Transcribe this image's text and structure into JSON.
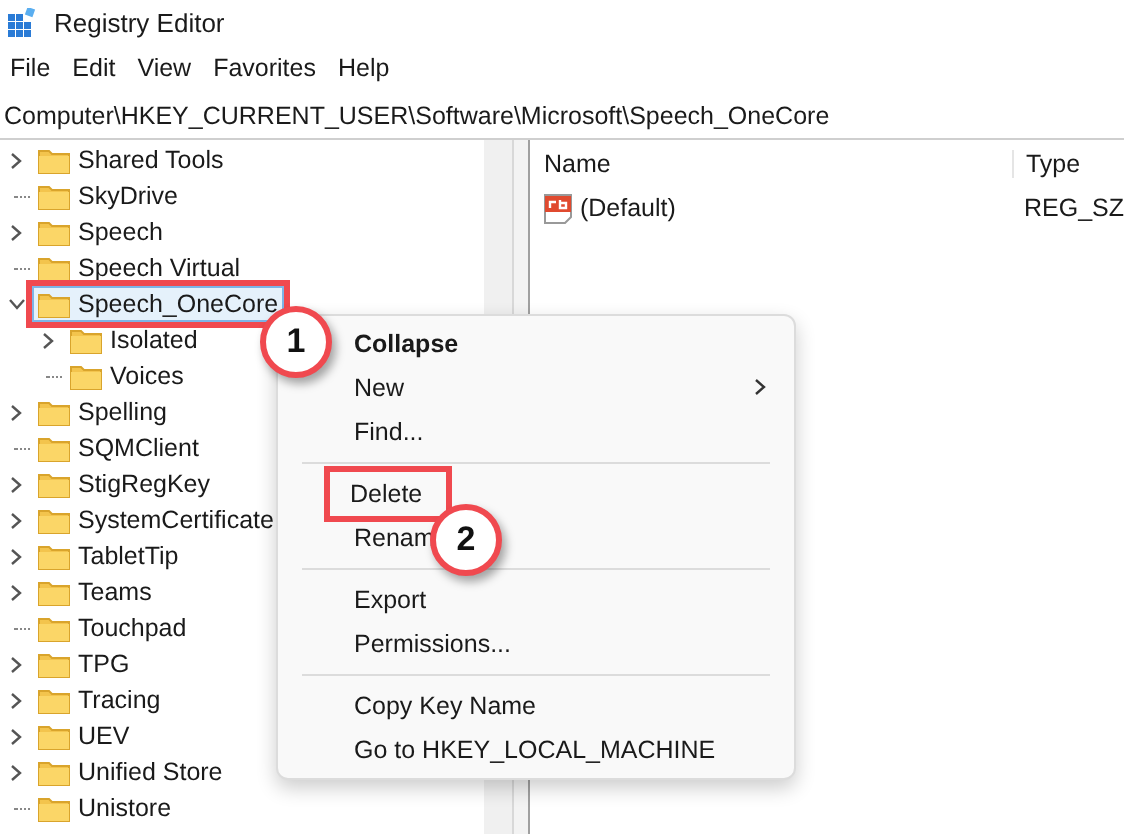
{
  "window": {
    "title": "Registry Editor"
  },
  "menu_bar": [
    "File",
    "Edit",
    "View",
    "Favorites",
    "Help"
  ],
  "address": "Computer\\HKEY_CURRENT_USER\\Software\\Microsoft\\Speech_OneCore",
  "tree": [
    {
      "label": "Shared Tools",
      "expandable": true,
      "expanded": false,
      "selected": false
    },
    {
      "label": "SkyDrive",
      "expandable": false,
      "selected": false
    },
    {
      "label": "Speech",
      "expandable": true,
      "expanded": false,
      "selected": false
    },
    {
      "label": "Speech Virtual",
      "expandable": false,
      "selected": false
    },
    {
      "label": "Speech_OneCore",
      "expandable": true,
      "expanded": true,
      "selected": true,
      "highlighted": true,
      "callout": "1",
      "children": [
        {
          "label": "Isolated",
          "expandable": true,
          "expanded": false,
          "selected": false
        },
        {
          "label": "Voices",
          "expandable": false,
          "selected": false
        }
      ]
    },
    {
      "label": "Spelling",
      "expandable": true,
      "expanded": false,
      "selected": false
    },
    {
      "label": "SQMClient",
      "expandable": false,
      "selected": false
    },
    {
      "label": "StigRegKey",
      "expandable": true,
      "expanded": false,
      "selected": false
    },
    {
      "label": "SystemCertificate",
      "expandable": true,
      "expanded": false,
      "selected": false
    },
    {
      "label": "TabletTip",
      "expandable": true,
      "expanded": false,
      "selected": false
    },
    {
      "label": "Teams",
      "expandable": true,
      "expanded": false,
      "selected": false
    },
    {
      "label": "Touchpad",
      "expandable": false,
      "selected": false
    },
    {
      "label": "TPG",
      "expandable": true,
      "expanded": false,
      "selected": false
    },
    {
      "label": "Tracing",
      "expandable": true,
      "expanded": false,
      "selected": false
    },
    {
      "label": "UEV",
      "expandable": true,
      "expanded": false,
      "selected": false
    },
    {
      "label": "Unified Store",
      "expandable": true,
      "expanded": false,
      "selected": false
    },
    {
      "label": "Unistore",
      "expandable": false,
      "selected": false
    }
  ],
  "values": {
    "columns": [
      "Name",
      "Type"
    ],
    "rows": [
      {
        "name": "(Default)",
        "type": "REG_SZ"
      }
    ]
  },
  "context_menu": [
    {
      "kind": "item",
      "label": "Collapse",
      "default": true
    },
    {
      "kind": "item",
      "label": "New",
      "submenu": true
    },
    {
      "kind": "item",
      "label": "Find..."
    },
    {
      "kind": "separator"
    },
    {
      "kind": "item",
      "label": "Delete",
      "highlighted": true,
      "callout": "2"
    },
    {
      "kind": "item",
      "label": "Renam"
    },
    {
      "kind": "separator"
    },
    {
      "kind": "item",
      "label": "Export"
    },
    {
      "kind": "item",
      "label": "Permissions..."
    },
    {
      "kind": "separator"
    },
    {
      "kind": "item",
      "label": "Copy Key Name"
    },
    {
      "kind": "item",
      "label": "Go to HKEY_LOCAL_MACHINE"
    }
  ]
}
